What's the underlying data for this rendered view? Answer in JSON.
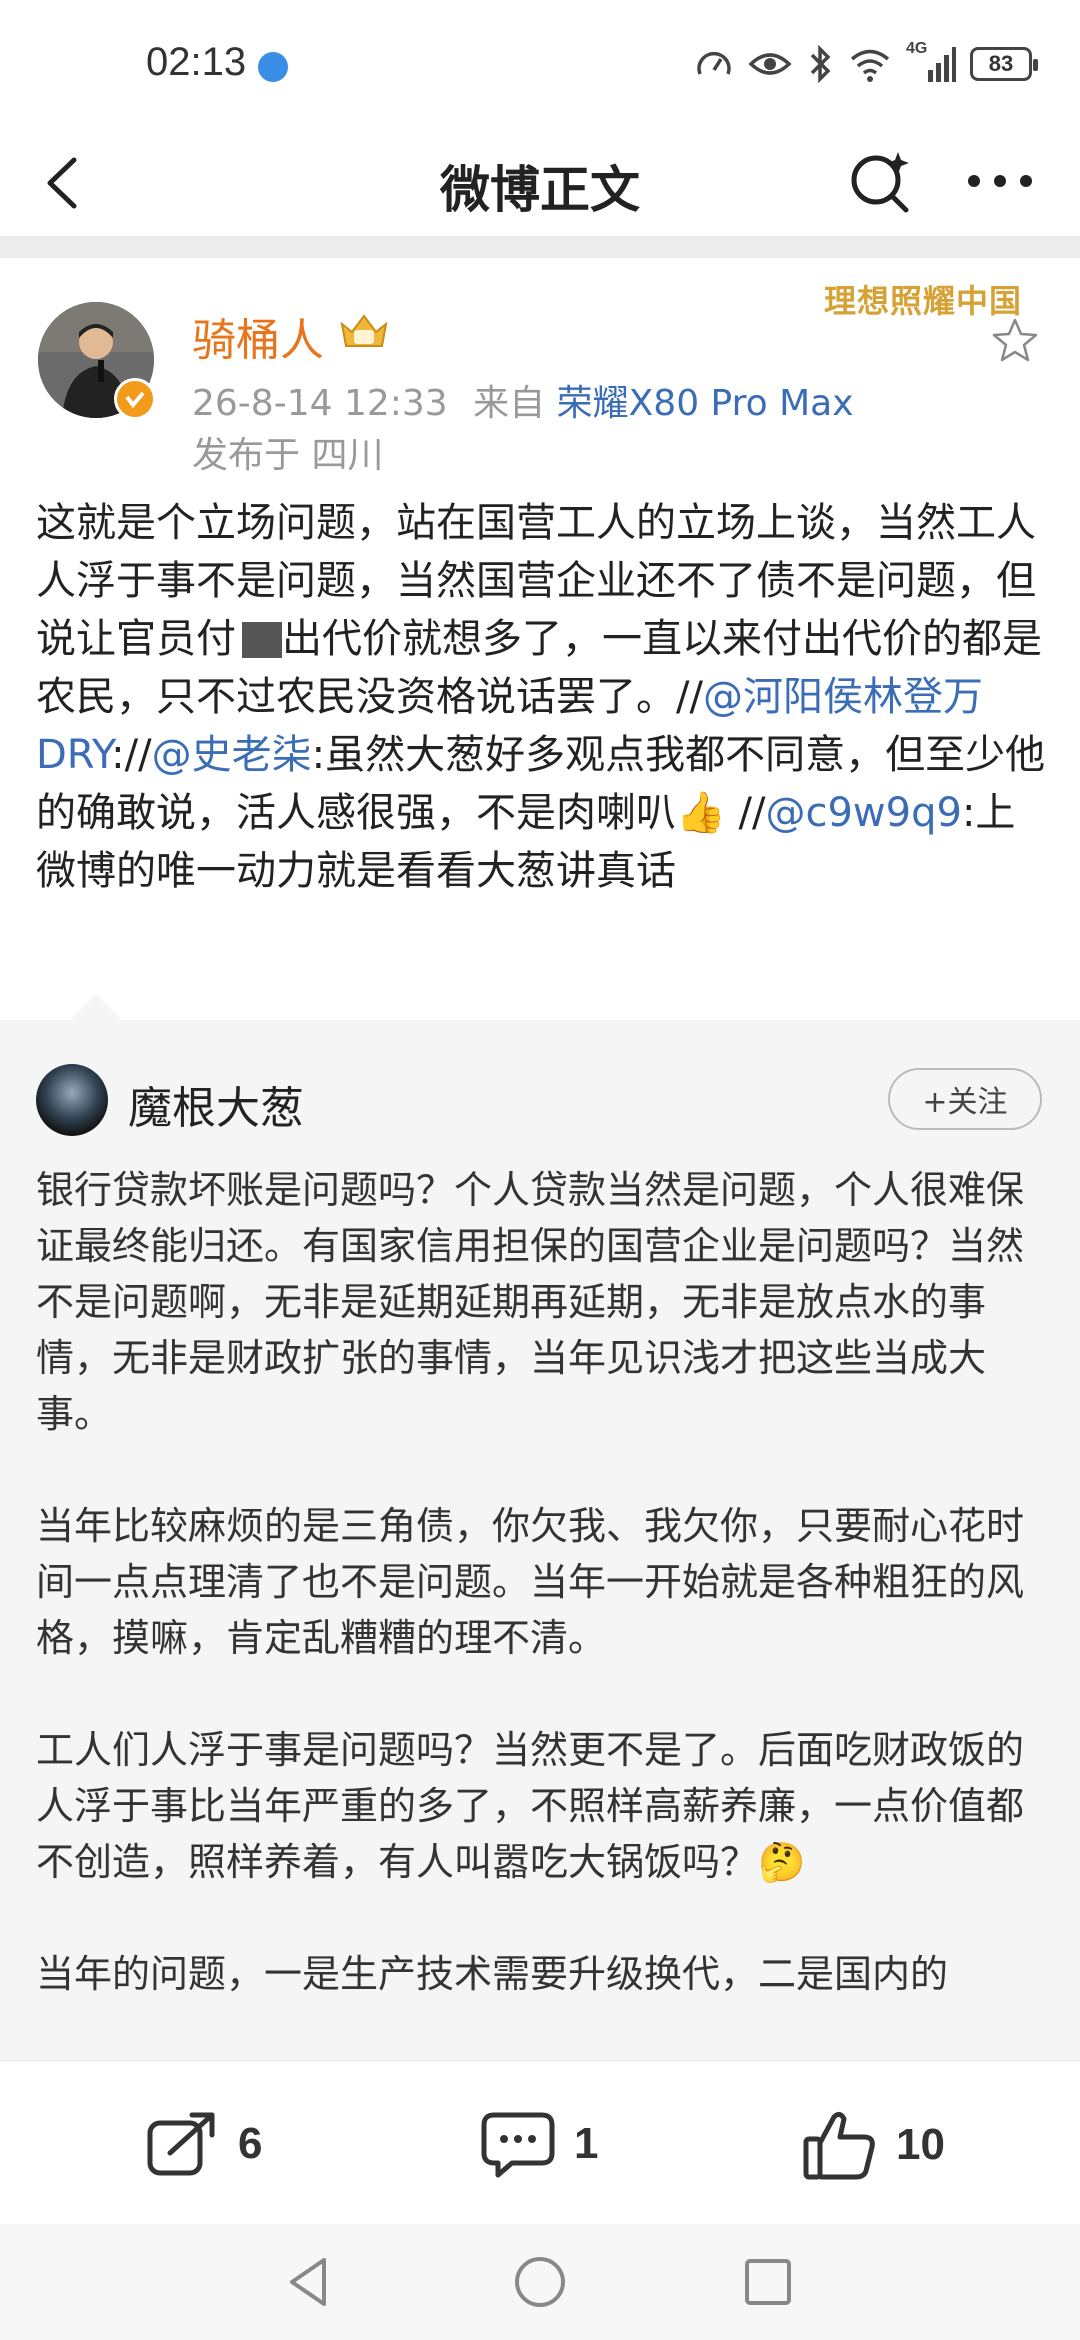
{
  "status_bar": {
    "time": "02:13",
    "signal_label": "4G",
    "battery": "83"
  },
  "nav": {
    "title": "微博正文"
  },
  "post": {
    "author": "骑桶人",
    "slogan": "理想照耀中国",
    "meta_time": "26-8-14 12:33",
    "meta_from": "来自",
    "meta_device": "荣耀X80 Pro Max",
    "location": "发布于 四川",
    "body": {
      "p1": "这就是个立场问题，站在国营工人的立场上谈，当然工人人浮于事不是问题，当然国营企业还不了债不是问题，但说让官员付",
      "p2": "出代价就想多了，一直以来付出代价的都是农民，只不过农民没资格说话罢了。//",
      "mention1": "@河阳侯林登万DRY",
      "sep1": "://",
      "mention2": "@史老柒",
      "p3": ":虽然大葱好多观点我都不同意，但至少他的确敢说，活人感很强，不是肉喇叭👍 //",
      "mention3": "@c9w9q9",
      "p4": ":上微博的唯一动力就是看看大葱讲真话"
    }
  },
  "original": {
    "author": "魔根大葱",
    "follow_label": "+关注",
    "paragraphs": [
      "银行贷款坏账是问题吗？个人贷款当然是问题，个人很难保证最终能归还。有国家信用担保的国营企业是问题吗？当然不是问题啊，无非是延期延期再延期，无非是放点水的事情，无非是财政扩张的事情，当年见识浅才把这些当成大事。",
      "当年比较麻烦的是三角债，你欠我、我欠你，只要耐心花时间一点点理清了也不是问题。当年一开始就是各种粗狂的风格，摸嘛，肯定乱糟糟的理不清。",
      "工人们人浮于事是问题吗？当然更不是了。后面吃财政饭的人浮于事比当年严重的多了，不照样高薪养廉，一点价值都不创造，照样养着，有人叫嚣吃大锅饭吗？🤔",
      "当年的问题，一是生产技术需要升级换代，二是国内的"
    ]
  },
  "actions": {
    "repost_count": "6",
    "comment_count": "1",
    "like_count": "10"
  },
  "icons": {
    "back": "back-arrow-icon",
    "search": "search-sparkle-icon",
    "more": "more-dots-icon",
    "star": "star-outline-icon",
    "repost": "repost-icon",
    "comment": "comment-icon",
    "like": "thumbs-up-icon"
  },
  "colors": {
    "author_orange": "#e8741c",
    "link_blue": "#3b6db6",
    "slogan_gold": "#d6a235"
  }
}
